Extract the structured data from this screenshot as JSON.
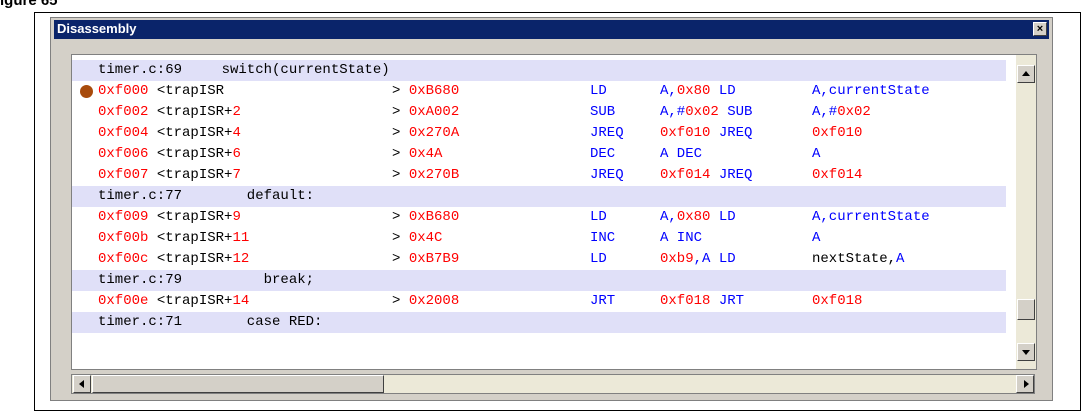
{
  "page": {
    "caption": "igure 65"
  },
  "window": {
    "title": "Disassembly",
    "close_glyph": "×"
  },
  "rows": [
    {
      "kind": "src",
      "file": "timer.c:69",
      "code": "    switch(currentState)"
    },
    {
      "kind": "asm",
      "bp": true,
      "addr": "0xf000",
      "sym": " <trapISR",
      "off": "",
      "gt": ">",
      "op": "0xB680",
      "mn": "LD",
      "a1": [
        [
          "A,",
          "blue"
        ],
        [
          "0x80",
          "red"
        ],
        [
          " LD",
          "blue"
        ]
      ],
      "a2": [
        [
          "A,currentState",
          "blue"
        ]
      ]
    },
    {
      "kind": "asm",
      "addr": "0xf002",
      "sym": " <trapISR+",
      "off": "2",
      "gt": ">",
      "op": "0xA002",
      "mn": "SUB",
      "a1": [
        [
          "A,#",
          "blue"
        ],
        [
          "0x02",
          "red"
        ],
        [
          " SUB",
          "blue"
        ]
      ],
      "a2": [
        [
          "A,#",
          "blue"
        ],
        [
          "0x02",
          "red"
        ]
      ]
    },
    {
      "kind": "asm",
      "addr": "0xf004",
      "sym": " <trapISR+",
      "off": "4",
      "gt": ">",
      "op": "0x270A",
      "mn": "JREQ",
      "a1": [
        [
          "0xf010",
          "red"
        ],
        [
          " JREQ",
          "blue"
        ]
      ],
      "a2": [
        [
          "0xf010",
          "red"
        ]
      ]
    },
    {
      "kind": "asm",
      "addr": "0xf006",
      "sym": " <trapISR+",
      "off": "6",
      "gt": ">",
      "op": "0x4A",
      "mn": "DEC",
      "a1": [
        [
          "A DEC",
          "blue"
        ]
      ],
      "a2": [
        [
          "A",
          "blue"
        ]
      ]
    },
    {
      "kind": "asm",
      "addr": "0xf007",
      "sym": " <trapISR+",
      "off": "7",
      "gt": ">",
      "op": "0x270B",
      "mn": "JREQ",
      "a1": [
        [
          "0xf014",
          "red"
        ],
        [
          " JREQ",
          "blue"
        ]
      ],
      "a2": [
        [
          "0xf014",
          "red"
        ]
      ]
    },
    {
      "kind": "src",
      "file": "timer.c:77",
      "code": "       default:"
    },
    {
      "kind": "asm",
      "addr": "0xf009",
      "sym": " <trapISR+",
      "off": "9",
      "gt": ">",
      "op": "0xB680",
      "mn": "LD",
      "a1": [
        [
          "A,",
          "blue"
        ],
        [
          "0x80",
          "red"
        ],
        [
          " LD",
          "blue"
        ]
      ],
      "a2": [
        [
          "A,currentState",
          "blue"
        ]
      ]
    },
    {
      "kind": "asm",
      "addr": "0xf00b",
      "sym": " <trapISR+",
      "off": "11",
      "gt": ">",
      "op": "0x4C",
      "mn": "INC",
      "a1": [
        [
          "A INC",
          "blue"
        ]
      ],
      "a2": [
        [
          "A",
          "blue"
        ]
      ]
    },
    {
      "kind": "asm",
      "addr": "0xf00c",
      "sym": " <trapISR+",
      "off": "12",
      "gt": ">",
      "op": "0xB7B9",
      "mn": "LD",
      "a1": [
        [
          "0xb9",
          "red"
        ],
        [
          ",A LD",
          "blue"
        ]
      ],
      "a2": [
        [
          "nextState,",
          "blk"
        ],
        [
          "A",
          "blue"
        ]
      ]
    },
    {
      "kind": "src",
      "file": "timer.c:79",
      "code": "         break;"
    },
    {
      "kind": "asm",
      "addr": "0xf00e",
      "sym": " <trapISR+",
      "off": "14",
      "gt": ">",
      "op": "0x2008",
      "mn": "JRT",
      "a1": [
        [
          "0xf018",
          "red"
        ],
        [
          " JRT",
          "blue"
        ]
      ],
      "a2": [
        [
          "0xf018",
          "red"
        ]
      ]
    },
    {
      "kind": "src",
      "file": "timer.c:71",
      "code": "       case RED:"
    }
  ],
  "colors": {
    "title_bg": "#0a246a",
    "src_row_bg": "#e0e0f8",
    "address": "#ff0000",
    "mnemonic": "#0000ff",
    "breakpoint": "#a84b0c"
  },
  "icons": {
    "breakpoint": "breakpoint-icon",
    "scroll_up": "arrow-up-icon",
    "scroll_down": "arrow-down-icon",
    "scroll_left": "arrow-left-icon",
    "scroll_right": "arrow-right-icon"
  }
}
